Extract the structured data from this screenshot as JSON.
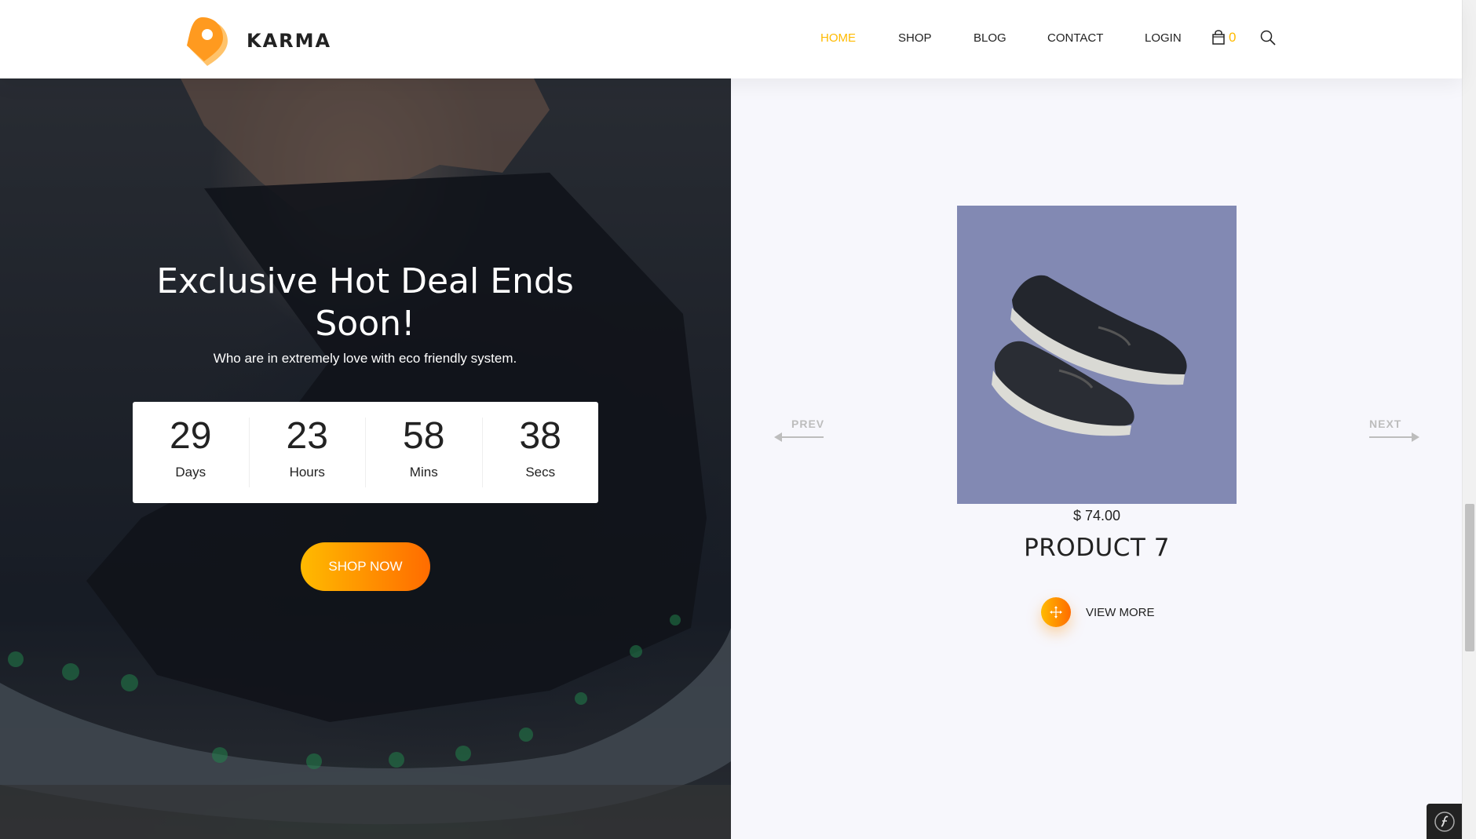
{
  "header": {
    "brand": "KARMA",
    "nav": [
      {
        "label": "HOME",
        "active": true
      },
      {
        "label": "SHOP",
        "active": false
      },
      {
        "label": "BLOG",
        "active": false
      },
      {
        "label": "CONTACT",
        "active": false
      },
      {
        "label": "LOGIN",
        "active": false
      }
    ],
    "cart_count": "0",
    "icons": {
      "cart": "shopping-bag-icon",
      "search": "search-icon",
      "logo": "location-pin-logo"
    }
  },
  "hero": {
    "title_line1": "Exclusive Hot Deal Ends",
    "title_line2": "Soon!",
    "subtitle": "Who are in extremely love with eco friendly system.",
    "countdown": [
      {
        "value": "29",
        "label": "Days"
      },
      {
        "value": "23",
        "label": "Hours"
      },
      {
        "value": "58",
        "label": "Mins"
      },
      {
        "value": "38",
        "label": "Secs"
      }
    ],
    "cta": "SHOP NOW"
  },
  "product": {
    "price": "$ 74.00",
    "name": "PRODUCT 7",
    "view_more": "VIEW MORE",
    "prev": "PREV",
    "next": "NEXT"
  },
  "colors": {
    "accent": "#ffba00",
    "accent_end": "#ff6c00",
    "product_bg": "#8289b3",
    "panel_bg": "#f7f7fc"
  }
}
